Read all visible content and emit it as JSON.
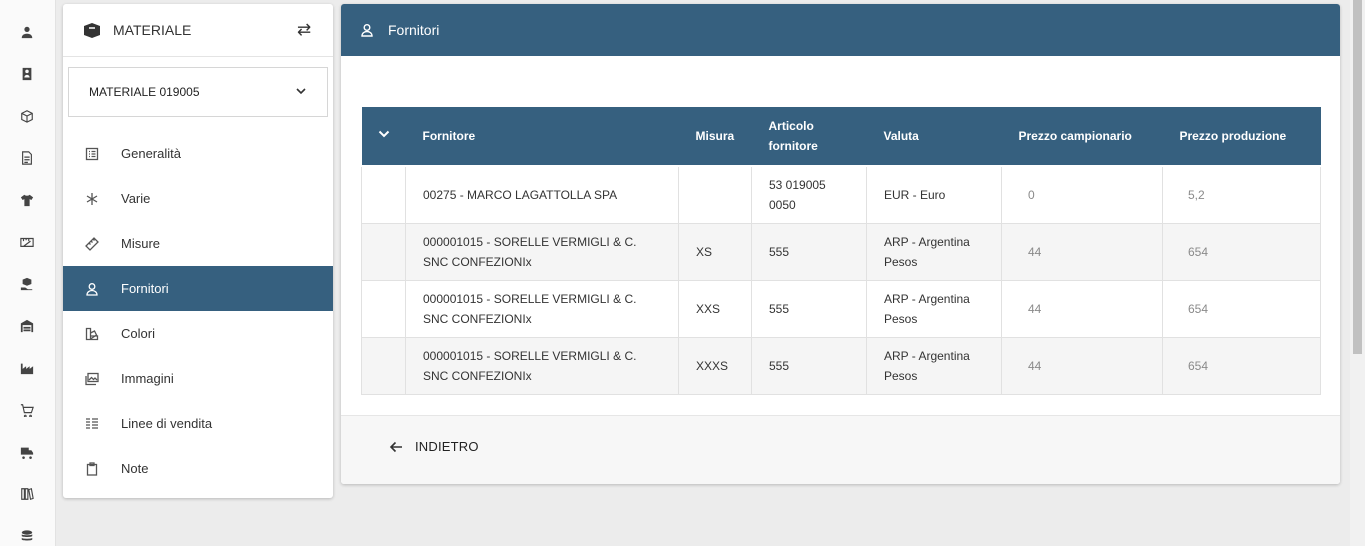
{
  "rail": [
    {
      "icon": "user-icon"
    },
    {
      "icon": "contact-card-icon"
    },
    {
      "icon": "box-open-icon"
    },
    {
      "icon": "document-icon"
    },
    {
      "icon": "tshirt-icon"
    },
    {
      "icon": "ruler-box-icon"
    },
    {
      "icon": "box-hand-icon"
    },
    {
      "icon": "warehouse-icon"
    },
    {
      "icon": "factory-icon"
    },
    {
      "icon": "cart-icon"
    },
    {
      "icon": "truck-icon"
    },
    {
      "icon": "books-icon"
    },
    {
      "icon": "coins-icon"
    }
  ],
  "side": {
    "title": "MATERIALE",
    "selected": "MATERIALE 019005",
    "menu": [
      {
        "label": "Generalità",
        "icon": "list-icon"
      },
      {
        "label": "Varie",
        "icon": "asterisk-icon"
      },
      {
        "label": "Misure",
        "icon": "ruler-icon"
      },
      {
        "label": "Fornitori",
        "icon": "supplier-icon"
      },
      {
        "label": "Colori",
        "icon": "palette-icon"
      },
      {
        "label": "Immagini",
        "icon": "image-icon"
      },
      {
        "label": "Linee di vendita",
        "icon": "lines-icon"
      },
      {
        "label": "Note",
        "icon": "clipboard-icon"
      }
    ],
    "active_index": 3
  },
  "main": {
    "title": "Fornitori",
    "columns": [
      "",
      "Fornitore",
      "Misura",
      "Articolo fornitore",
      "Valuta",
      "Prezzo campionario",
      "Prezzo produzione"
    ],
    "rows": [
      {
        "fornitore": "00275 - MARCO LAGATTOLLA SPA",
        "misura": "",
        "articolo": "53 019005 0050",
        "valuta": "EUR - Euro",
        "campionario": "0",
        "produzione": "5,2"
      },
      {
        "fornitore": "000001015 - SORELLE VERMIGLI & C. SNC CONFEZIONIx",
        "misura": "XS",
        "articolo": "555",
        "valuta": "ARP - Argentina Pesos",
        "campionario": "44",
        "produzione": "654"
      },
      {
        "fornitore": "000001015 - SORELLE VERMIGLI & C. SNC CONFEZIONIx",
        "misura": "XXS",
        "articolo": "555",
        "valuta": "ARP - Argentina Pesos",
        "campionario": "44",
        "produzione": "654"
      },
      {
        "fornitore": "000001015 - SORELLE VERMIGLI & C. SNC CONFEZIONIx",
        "misura": "XXXS",
        "articolo": "555",
        "valuta": "ARP - Argentina Pesos",
        "campionario": "44",
        "produzione": "654"
      }
    ],
    "back_label": "INDIETRO"
  },
  "colors": {
    "header": "#36607f"
  }
}
